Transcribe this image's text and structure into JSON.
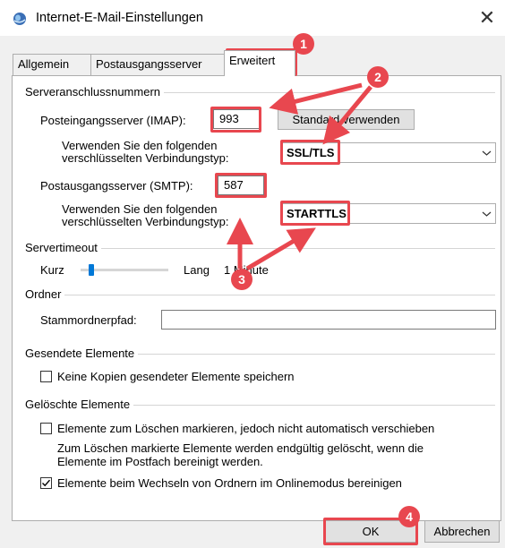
{
  "window": {
    "title": "Internet-E-Mail-Einstellungen",
    "close_glyph": "✕"
  },
  "tabs": [
    {
      "label": "Allgemein",
      "active": false
    },
    {
      "label": "Postausgangsserver",
      "active": false
    },
    {
      "label": "Erweitert",
      "active": true
    }
  ],
  "server_ports": {
    "group_label": "Serveranschlussnummern",
    "imap_label": "Posteingangsserver (IMAP):",
    "imap_value": "993",
    "default_button": "Standard verwenden",
    "imap_encryption_label_1": "Verwenden Sie den folgenden",
    "imap_encryption_label_2": "verschlüsselten Verbindungstyp:",
    "imap_encryption_value": "SSL/TLS",
    "smtp_label": "Postausgangsserver (SMTP):",
    "smtp_value": "587",
    "smtp_encryption_label_1": "Verwenden Sie den folgenden",
    "smtp_encryption_label_2": "verschlüsselten Verbindungstyp:",
    "smtp_encryption_value": "STARTTLS"
  },
  "timeout": {
    "group_label": "Servertimeout",
    "short_label": "Kurz",
    "long_label": "Lang",
    "value_text": "1 Minute",
    "slider_fraction": 0.1
  },
  "folders": {
    "group_label": "Ordner",
    "root_path_label": "Stammordnerpfad:",
    "root_path_value": ""
  },
  "sent_items": {
    "group_label": "Gesendete Elemente",
    "no_copies_label": "Keine Kopien gesendeter Elemente speichern",
    "no_copies_checked": false
  },
  "deleted_items": {
    "group_label": "Gelöschte Elemente",
    "mark_label": "Elemente zum Löschen markieren, jedoch nicht automatisch verschieben",
    "mark_checked": false,
    "info_line_1": "Zum Löschen markierte Elemente werden endgültig gelöscht, wenn die",
    "info_line_2": "Elemente im Postfach bereinigt werden.",
    "purge_label": "Elemente beim Wechseln von Ordnern im Onlinemodus bereinigen",
    "purge_checked": true
  },
  "buttons": {
    "ok": "OK",
    "cancel": "Abbrechen"
  },
  "annotations": {
    "badges": [
      "1",
      "2",
      "3",
      "4"
    ],
    "color": "#e8474f"
  }
}
